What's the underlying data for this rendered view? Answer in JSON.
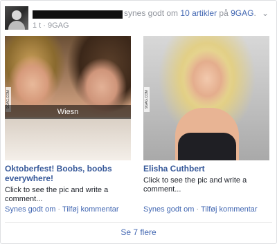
{
  "header": {
    "story_text": "synes godt om",
    "story_link": "10 artikler",
    "story_on": "på",
    "story_page": "9GAG",
    "story_end": ".",
    "meta_time": "1 t",
    "meta_sep": "·",
    "meta_page": "9GAG",
    "menu_icon": "chevron-down-icon"
  },
  "items": [
    {
      "photo_caption": "Wiesn",
      "watermark": "9GAG.COM",
      "title": "Oktoberfest! Boobs, boobs everywhere!",
      "description": "Click to see the pic and write a comment...",
      "like_label": "Synes godt om",
      "sep": "·",
      "comment_label": "Tilføj kommentar"
    },
    {
      "watermark": "9GAG.COM",
      "title": "Elisha Cuthbert",
      "description": "Click to see the pic and write a comment...",
      "like_label": "Synes godt om",
      "sep": "·",
      "comment_label": "Tilføj kommentar"
    }
  ],
  "see_more": "Se 7 flere",
  "colors": {
    "link": "#4267b2",
    "title": "#365899",
    "muted": "#90949c"
  }
}
